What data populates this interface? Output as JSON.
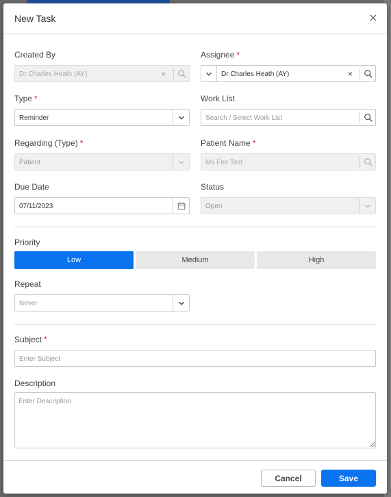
{
  "dialog": {
    "title": "New Task"
  },
  "fields": {
    "created_by": {
      "label": "Created By",
      "value": "Dr Charles Heath (AY)"
    },
    "assignee": {
      "label": "Assignee",
      "required_mark": "*",
      "value": "Dr Charles Heath (AY)"
    },
    "type": {
      "label": "Type",
      "required_mark": "*",
      "value": "Reminder"
    },
    "work_list": {
      "label": "Work List",
      "placeholder": "Search / Select Work List"
    },
    "regarding_type": {
      "label": "Regarding (Type)",
      "required_mark": "*",
      "value": "Patient"
    },
    "patient_name": {
      "label": "Patient Name",
      "required_mark": "*",
      "value": "Ms Fee Test"
    },
    "due_date": {
      "label": "Due Date",
      "value": "07/11/2023"
    },
    "status": {
      "label": "Status",
      "value": "Open"
    },
    "priority": {
      "label": "Priority",
      "options": [
        "Low",
        "Medium",
        "High"
      ],
      "selected": "Low"
    },
    "repeat": {
      "label": "Repeat",
      "value": "Never"
    },
    "subject": {
      "label": "Subject",
      "required_mark": "*",
      "placeholder": "Enter Subject"
    },
    "description": {
      "label": "Description",
      "placeholder": "Enter Description"
    }
  },
  "footer": {
    "cancel_label": "Cancel",
    "save_label": "Save"
  },
  "colors": {
    "primary": "#0a74f0",
    "required": "#e02020"
  }
}
